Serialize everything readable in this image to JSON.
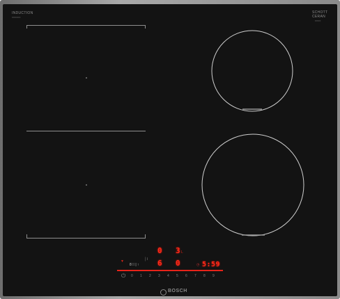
{
  "branding": {
    "induction_label": "INDUCTION",
    "induction_sub": "━━━━━━",
    "series_label": "SCHOTT",
    "series_sub": "CERAN",
    "series_tag": "━━━━",
    "logo_text": "BOSCH"
  },
  "displays": {
    "top_left_digit": "0",
    "top_right_digit": "3",
    "top_right_suffix": "L",
    "mid_left_digit": "6",
    "mid_right_digit": "0",
    "timer_value": "5:59",
    "timer_prefix": "◷",
    "left_indicator": "8 ⁞⁞ | ↑",
    "left_indicator_sub": "│⌇"
  },
  "slider": {
    "digits": [
      "0",
      "1",
      "2",
      "3",
      "4",
      "5",
      "6",
      "7",
      "8",
      "9"
    ],
    "power_symbol": "⏻",
    "minus_symbol": "−",
    "plus_symbol": "+"
  },
  "colors": {
    "glass": "#131313",
    "display_red": "#ff2a1a",
    "frame": "#8a8a8a"
  }
}
